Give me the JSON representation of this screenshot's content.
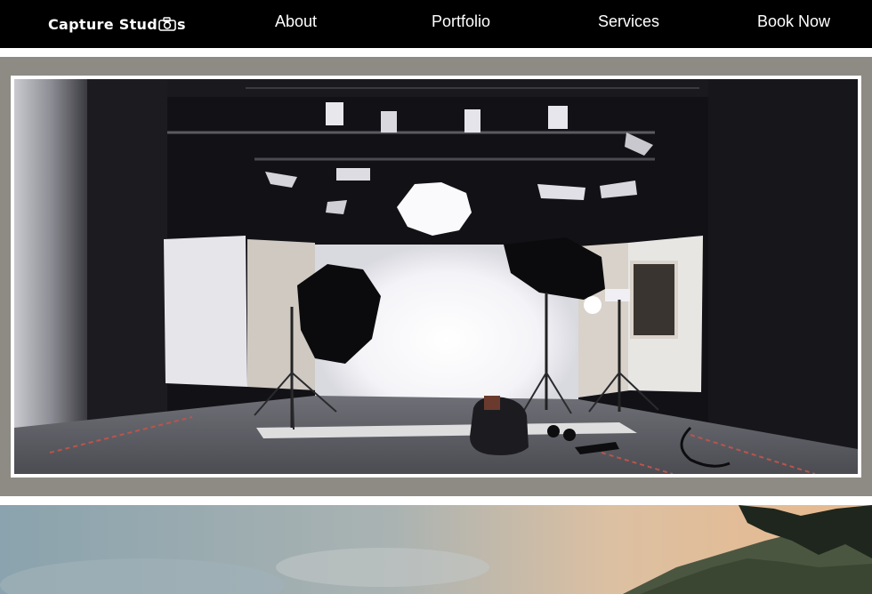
{
  "navbar": {
    "logo_text_before": "Capture Stud",
    "logo_text_after": "s",
    "logo_icon": "camera-icon",
    "links": [
      {
        "label": "About"
      },
      {
        "label": "Portfolio"
      },
      {
        "label": "Services"
      },
      {
        "label": "Book Now"
      }
    ]
  },
  "hero": {
    "image_subject": "photography studio with softbox lights",
    "band_color": "#8e8b84"
  },
  "landscape": {
    "image_subject": "sunset sky over forested hillside"
  },
  "colors": {
    "nav_background": "#000000",
    "nav_text": "#ffffff",
    "frame_border": "#ffffff"
  }
}
